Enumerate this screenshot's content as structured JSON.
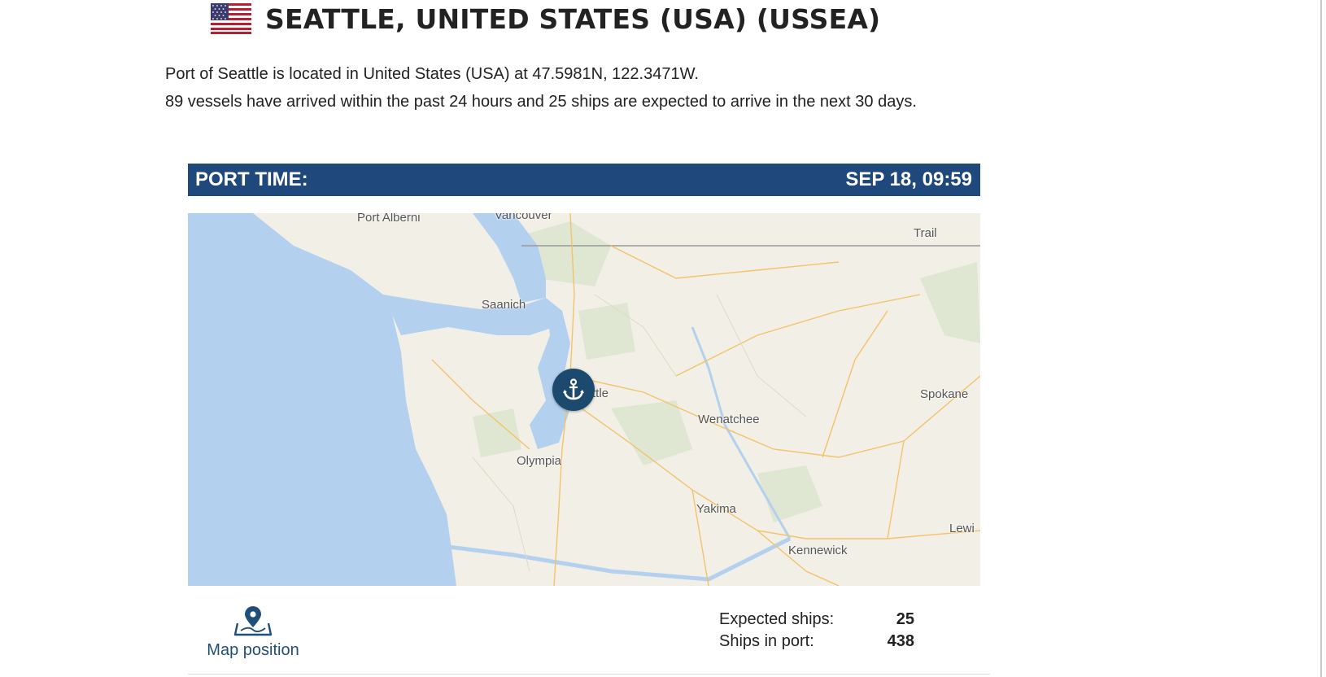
{
  "page_title": "SEATTLE, UNITED STATES (USA) (USSEA)",
  "flag_icon": "us-flag-icon",
  "description": {
    "line1": "Port of Seattle is located in United States (USA) at 47.5981N, 122.3471W.",
    "line2": "89 vessels have arrived within the past 24 hours and 25 ships are expected to arrive in the next 30 days."
  },
  "port_time": {
    "label": "PORT TIME:",
    "value": "SEP 18, 09:59",
    "bar_color": "#1f487c"
  },
  "map": {
    "pin_icon": "anchor-icon",
    "pin_color": "#1c4a6e",
    "water_color": "#b3d1ee",
    "land_color": "#f2efe6",
    "labels": {
      "port_alberni": "Port Alberni",
      "vancouver": "Vancouver",
      "trail": "Trail",
      "saanich": "Saanich",
      "seattle_partial": "ttle",
      "spokane": "Spokane",
      "wenatchee": "Wenatchee",
      "olympia": "Olympia",
      "yakima": "Yakima",
      "kennewick": "Kennewick",
      "lewi": "Lewi"
    }
  },
  "map_position": {
    "icon": "map-pin-icon",
    "label": "Map position"
  },
  "stats": {
    "expected_ships_label": "Expected ships:",
    "expected_ships_value": "25",
    "ships_in_port_label": "Ships in port:",
    "ships_in_port_value": "438"
  }
}
